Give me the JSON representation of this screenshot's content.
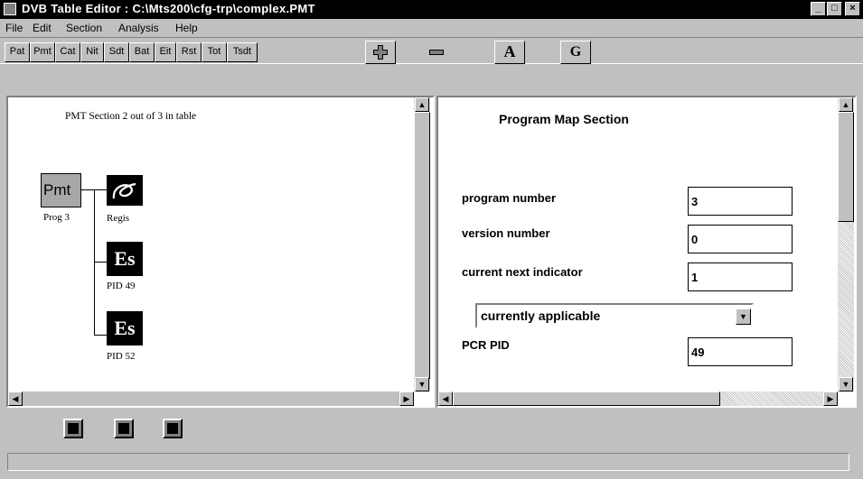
{
  "window": {
    "title": "DVB Table Editor : C:\\Mts200\\cfg-trp\\complex.PMT",
    "controls": [
      "_",
      "□",
      "×"
    ]
  },
  "menu": [
    "File",
    "Edit",
    "Section",
    "Analysis",
    "Help"
  ],
  "toolbar": {
    "tables": [
      "Pat",
      "Pmt",
      "Cat",
      "Nit",
      "Sdt",
      "Bat",
      "Eit",
      "Rst",
      "Tot",
      "Tsdt"
    ],
    "add_icon": "plus-icon",
    "remove_icon": "minus-icon",
    "a_label": "A",
    "g_label": "G"
  },
  "tree": {
    "header": "PMT Section 2 out of 3 in table",
    "root": {
      "label": "Pmt",
      "caption": "Prog 3"
    },
    "regis": {
      "icon": "regis-icon",
      "caption": "Regis"
    },
    "es1": {
      "label": "Es",
      "caption": "PID 49"
    },
    "es2": {
      "label": "Es",
      "caption": "PID 52"
    }
  },
  "form": {
    "title": "Program Map Section",
    "program_number_label": "program number",
    "program_number": "3",
    "version_number_label": "version number",
    "version_number": "0",
    "current_next_label": "current next indicator",
    "current_next": "1",
    "applicability": "currently applicable",
    "pcr_pid_label": "PCR PID",
    "pcr_pid": "49"
  },
  "nav": [
    "prev-section-icon",
    "info-icon",
    "next-section-icon"
  ],
  "status": ""
}
